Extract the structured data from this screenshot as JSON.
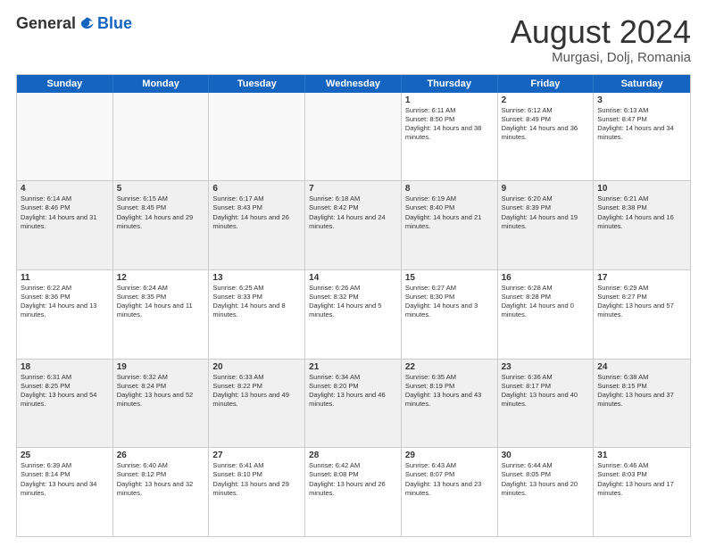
{
  "logo": {
    "general": "General",
    "blue": "Blue"
  },
  "header": {
    "month": "August 2024",
    "location": "Murgasi, Dolj, Romania"
  },
  "days": [
    "Sunday",
    "Monday",
    "Tuesday",
    "Wednesday",
    "Thursday",
    "Friday",
    "Saturday"
  ],
  "weeks": [
    [
      {
        "day": "",
        "info": ""
      },
      {
        "day": "",
        "info": ""
      },
      {
        "day": "",
        "info": ""
      },
      {
        "day": "",
        "info": ""
      },
      {
        "day": "1",
        "info": "Sunrise: 6:11 AM\nSunset: 8:50 PM\nDaylight: 14 hours and 38 minutes."
      },
      {
        "day": "2",
        "info": "Sunrise: 6:12 AM\nSunset: 8:49 PM\nDaylight: 14 hours and 36 minutes."
      },
      {
        "day": "3",
        "info": "Sunrise: 6:13 AM\nSunset: 8:47 PM\nDaylight: 14 hours and 34 minutes."
      }
    ],
    [
      {
        "day": "4",
        "info": "Sunrise: 6:14 AM\nSunset: 8:46 PM\nDaylight: 14 hours and 31 minutes."
      },
      {
        "day": "5",
        "info": "Sunrise: 6:15 AM\nSunset: 8:45 PM\nDaylight: 14 hours and 29 minutes."
      },
      {
        "day": "6",
        "info": "Sunrise: 6:17 AM\nSunset: 8:43 PM\nDaylight: 14 hours and 26 minutes."
      },
      {
        "day": "7",
        "info": "Sunrise: 6:18 AM\nSunset: 8:42 PM\nDaylight: 14 hours and 24 minutes."
      },
      {
        "day": "8",
        "info": "Sunrise: 6:19 AM\nSunset: 8:40 PM\nDaylight: 14 hours and 21 minutes."
      },
      {
        "day": "9",
        "info": "Sunrise: 6:20 AM\nSunset: 8:39 PM\nDaylight: 14 hours and 19 minutes."
      },
      {
        "day": "10",
        "info": "Sunrise: 6:21 AM\nSunset: 8:38 PM\nDaylight: 14 hours and 16 minutes."
      }
    ],
    [
      {
        "day": "11",
        "info": "Sunrise: 6:22 AM\nSunset: 8:36 PM\nDaylight: 14 hours and 13 minutes."
      },
      {
        "day": "12",
        "info": "Sunrise: 6:24 AM\nSunset: 8:35 PM\nDaylight: 14 hours and 11 minutes."
      },
      {
        "day": "13",
        "info": "Sunrise: 6:25 AM\nSunset: 8:33 PM\nDaylight: 14 hours and 8 minutes."
      },
      {
        "day": "14",
        "info": "Sunrise: 6:26 AM\nSunset: 8:32 PM\nDaylight: 14 hours and 5 minutes."
      },
      {
        "day": "15",
        "info": "Sunrise: 6:27 AM\nSunset: 8:30 PM\nDaylight: 14 hours and 3 minutes."
      },
      {
        "day": "16",
        "info": "Sunrise: 6:28 AM\nSunset: 8:28 PM\nDaylight: 14 hours and 0 minutes."
      },
      {
        "day": "17",
        "info": "Sunrise: 6:29 AM\nSunset: 8:27 PM\nDaylight: 13 hours and 57 minutes."
      }
    ],
    [
      {
        "day": "18",
        "info": "Sunrise: 6:31 AM\nSunset: 8:25 PM\nDaylight: 13 hours and 54 minutes."
      },
      {
        "day": "19",
        "info": "Sunrise: 6:32 AM\nSunset: 8:24 PM\nDaylight: 13 hours and 52 minutes."
      },
      {
        "day": "20",
        "info": "Sunrise: 6:33 AM\nSunset: 8:22 PM\nDaylight: 13 hours and 49 minutes."
      },
      {
        "day": "21",
        "info": "Sunrise: 6:34 AM\nSunset: 8:20 PM\nDaylight: 13 hours and 46 minutes."
      },
      {
        "day": "22",
        "info": "Sunrise: 6:35 AM\nSunset: 8:19 PM\nDaylight: 13 hours and 43 minutes."
      },
      {
        "day": "23",
        "info": "Sunrise: 6:36 AM\nSunset: 8:17 PM\nDaylight: 13 hours and 40 minutes."
      },
      {
        "day": "24",
        "info": "Sunrise: 6:38 AM\nSunset: 8:15 PM\nDaylight: 13 hours and 37 minutes."
      }
    ],
    [
      {
        "day": "25",
        "info": "Sunrise: 6:39 AM\nSunset: 8:14 PM\nDaylight: 13 hours and 34 minutes."
      },
      {
        "day": "26",
        "info": "Sunrise: 6:40 AM\nSunset: 8:12 PM\nDaylight: 13 hours and 32 minutes."
      },
      {
        "day": "27",
        "info": "Sunrise: 6:41 AM\nSunset: 8:10 PM\nDaylight: 13 hours and 29 minutes."
      },
      {
        "day": "28",
        "info": "Sunrise: 6:42 AM\nSunset: 8:08 PM\nDaylight: 13 hours and 26 minutes."
      },
      {
        "day": "29",
        "info": "Sunrise: 6:43 AM\nSunset: 8:07 PM\nDaylight: 13 hours and 23 minutes."
      },
      {
        "day": "30",
        "info": "Sunrise: 6:44 AM\nSunset: 8:05 PM\nDaylight: 13 hours and 20 minutes."
      },
      {
        "day": "31",
        "info": "Sunrise: 6:46 AM\nSunset: 8:03 PM\nDaylight: 13 hours and 17 minutes."
      }
    ]
  ]
}
